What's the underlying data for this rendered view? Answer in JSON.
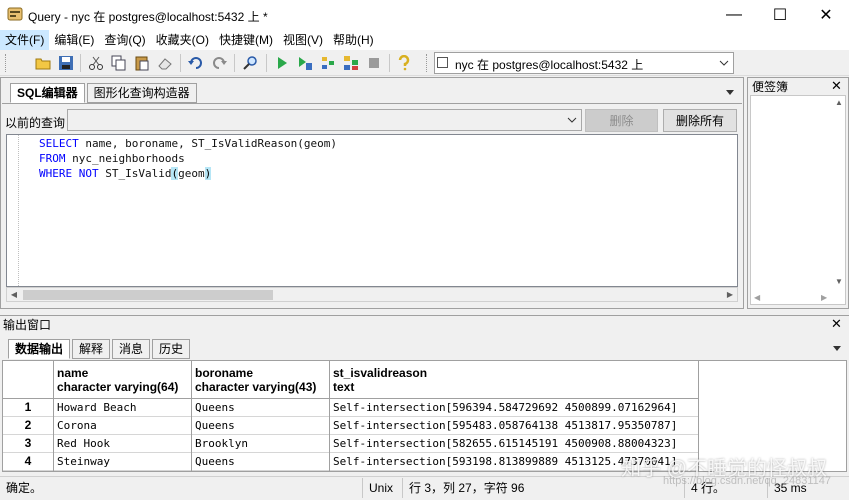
{
  "window": {
    "title": "Query - nyc 在  postgres@localhost:5432 上 *",
    "controls": {
      "minimize": "—",
      "maximize": "☐",
      "close": "✕"
    }
  },
  "menu": [
    "文件(F)",
    "编辑(E)",
    "查询(Q)",
    "收藏夹(O)",
    "快捷键(M)",
    "视图(V)",
    "帮助(H)"
  ],
  "toolbar": {
    "icons": [
      "open-icon",
      "save-icon",
      "cut-icon",
      "copy-icon",
      "paste-icon",
      "clear-icon",
      "undo-icon",
      "redo-icon",
      "find-icon",
      "execute-icon",
      "execute-pgscript-icon",
      "explain-icon",
      "explain-analyze-icon",
      "cancel-icon",
      "help-icon"
    ],
    "connection": "nyc 在  postgres@localhost:5432 上"
  },
  "editor": {
    "tabs": [
      "SQL编辑器",
      "图形化查询构造器"
    ],
    "previous_query_label": "以前的查询",
    "delete_label": "删除",
    "delete_all_label": "删除所有",
    "lines": [
      [
        {
          "t": "SELECT",
          "k": "kw"
        },
        {
          "t": " name, boroname, ST_IsValidReason(geom)",
          "k": "fn"
        }
      ],
      [
        {
          "t": "FROM",
          "k": "kw"
        },
        {
          "t": " nyc_neighborhoods",
          "k": "fn"
        }
      ],
      [
        {
          "t": "WHERE NOT",
          "k": "kw"
        },
        {
          "t": " ST_IsValid",
          "k": "fn"
        },
        {
          "t": "(",
          "k": "hl"
        },
        {
          "t": "geom",
          "k": "fn"
        },
        {
          "t": ")",
          "k": "hl"
        }
      ]
    ]
  },
  "bookmarks": {
    "title": "便签簿"
  },
  "output": {
    "title": "输出窗口",
    "tabs": [
      "数据输出",
      "解释",
      "消息",
      "历史"
    ],
    "columns": [
      {
        "name": "name",
        "type": "character varying(64)"
      },
      {
        "name": "boroname",
        "type": "character varying(43)"
      },
      {
        "name": "st_isvalidreason",
        "type": "text"
      }
    ],
    "rows": [
      {
        "num": "1",
        "name": "Howard Beach",
        "boroname": "Queens",
        "reason": "Self-intersection[596394.584729692 4500899.07162964]"
      },
      {
        "num": "2",
        "name": "Corona",
        "boroname": "Queens",
        "reason": "Self-intersection[595483.058764138 4513817.95350787]"
      },
      {
        "num": "3",
        "name": "Red Hook",
        "boroname": "Brooklyn",
        "reason": "Self-intersection[582655.615145191 4500908.88004323]"
      },
      {
        "num": "4",
        "name": "Steinway",
        "boroname": "Queens",
        "reason": "Self-intersection[593198.813899889 4513125.47370041]"
      }
    ]
  },
  "status": {
    "message": "确定。",
    "encoding": "Unix",
    "position": "行 3，列 27，字符 96",
    "rows": "4 行。",
    "time": "35 ms"
  },
  "watermark": {
    "text": "知乎 @不睡觉的怪叔叔",
    "url": "https://blog.csdn.net/qq_24831147"
  }
}
